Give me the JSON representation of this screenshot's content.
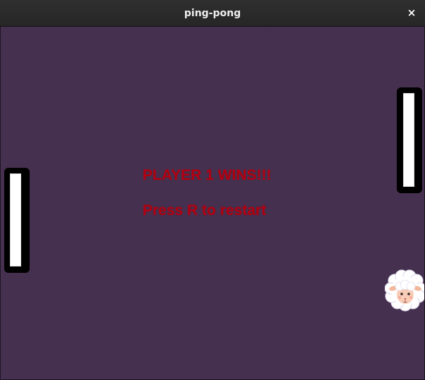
{
  "window": {
    "title": "ping-pong",
    "close_glyph": "×"
  },
  "game": {
    "background_color": "#46304f",
    "paddle_left": {
      "color": "#ffffff",
      "outline": "#000000"
    },
    "paddle_right": {
      "color": "#ffffff",
      "outline": "#000000"
    },
    "ball_icon": "sheep-icon",
    "message_color": "#b00010",
    "win_text": "PLAYER 1 WINS!!!",
    "restart_text": "Press R to restart"
  }
}
